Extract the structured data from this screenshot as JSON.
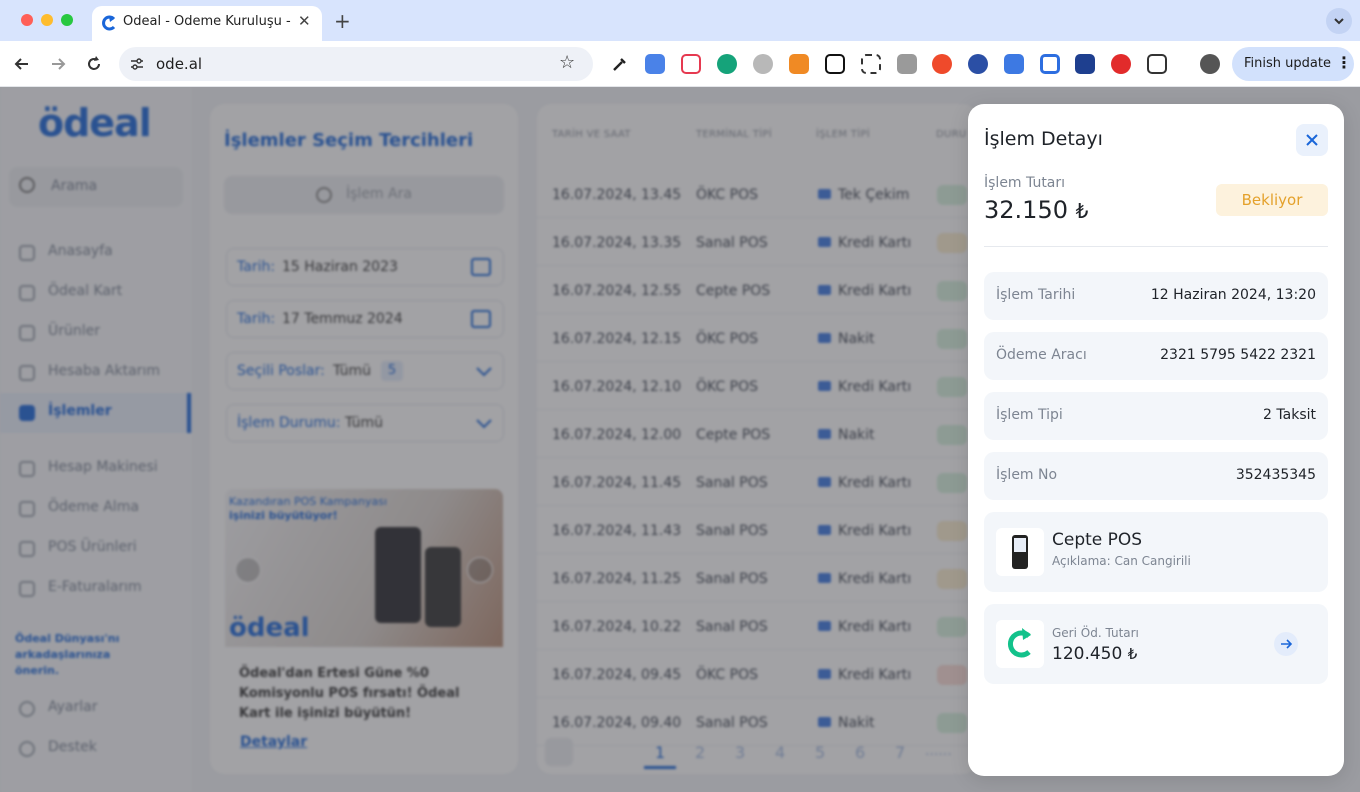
{
  "browser": {
    "tab_title": "Ödeal - Ödeme Kuruluşu - POS",
    "url": "ode.al",
    "finish_update_label": "Finish update",
    "traffic_colors": [
      "#ff5f57",
      "#febc2e",
      "#28c840"
    ]
  },
  "sidebar": {
    "logo": "ödeal",
    "search_label": "Arama",
    "items": [
      {
        "label": "Anasayfa",
        "icon": "home-icon"
      },
      {
        "label": "Ödeal Kart",
        "icon": "card-icon"
      },
      {
        "label": "Ürünler",
        "icon": "product-icon"
      },
      {
        "label": "Hesaba Aktarım",
        "icon": "transfer-icon"
      },
      {
        "label": "İşlemler",
        "icon": "transactions-icon"
      },
      {
        "label": "Hesap Makinesi",
        "icon": "calculator-icon"
      },
      {
        "label": "Ödeme Alma",
        "icon": "payment-icon"
      },
      {
        "label": "POS Ürünleri",
        "icon": "pos-icon"
      },
      {
        "label": "E-Faturalarım",
        "icon": "invoice-icon"
      },
      {
        "label": "Ayarlar",
        "icon": "settings-icon"
      },
      {
        "label": "Destek",
        "icon": "support-icon"
      }
    ],
    "promo": "Ödeal Dünyası'nı arkadaşlarınıza önerin."
  },
  "filters": {
    "title": "İşlemler Seçim Tercihleri",
    "search_placeholder": "İşlem Ara",
    "date_from_label": "Tarih:",
    "date_from_value": "15 Haziran 2023",
    "date_to_label": "Tarih:",
    "date_to_value": "17 Temmuz 2024",
    "pos_label": "Seçili Poslar:",
    "pos_value": "Tümü",
    "pos_count": "5",
    "status_label": "İşlem Durumu:",
    "status_value": "Tümü",
    "banner_line1": "Kazandıran POS Kampanyası",
    "banner_line2": "işinizi büyütüyor!",
    "banner_logo": "ödeal",
    "promo_text": "Ödeal'dan Ertesi Güne %0 Komisyonlu POS fırsatı! Ödeal Kart ile işinizi büyütün!",
    "promo_link": "Detaylar"
  },
  "table": {
    "headers": [
      "TARİH VE SAAT",
      "TERMİNAL TİPİ",
      "İŞLEM TİPİ",
      "DURU"
    ],
    "rows": [
      {
        "date": "16.07.2024, 13.45",
        "terminal": "ÖKC POS",
        "type": "Tek Çekim",
        "status_color": "#d7f2df"
      },
      {
        "date": "16.07.2024, 13.35",
        "terminal": "Sanal POS",
        "type": "Kredi Kartı",
        "status_color": "#fbedcf"
      },
      {
        "date": "16.07.2024, 12.55",
        "terminal": "Cepte POS",
        "type": "Kredi Kartı",
        "status_color": "#d7f2df"
      },
      {
        "date": "16.07.2024, 12.15",
        "terminal": "ÖKC POS",
        "type": "Nakit",
        "status_color": "#d7f2df"
      },
      {
        "date": "16.07.2024, 12.10",
        "terminal": "ÖKC POS",
        "type": "Kredi Kartı",
        "status_color": "#d7f2df"
      },
      {
        "date": "16.07.2024, 12.00",
        "terminal": "Cepte POS",
        "type": "Nakit",
        "status_color": "#d7f2df"
      },
      {
        "date": "16.07.2024, 11.45",
        "terminal": "Sanal POS",
        "type": "Kredi Kartı",
        "status_color": "#d7f2df"
      },
      {
        "date": "16.07.2024, 11.43",
        "terminal": "Sanal POS",
        "type": "Kredi Kartı",
        "status_color": "#fbedcf"
      },
      {
        "date": "16.07.2024, 11.25",
        "terminal": "Sanal POS",
        "type": "Kredi Kartı",
        "status_color": "#fbedcf"
      },
      {
        "date": "16.07.2024, 10.22",
        "terminal": "Sanal POS",
        "type": "Kredi Kartı",
        "status_color": "#d7f2df"
      },
      {
        "date": "16.07.2024, 09.45",
        "terminal": "ÖKC POS",
        "type": "Kredi Kartı",
        "status_color": "#fbdcd6"
      },
      {
        "date": "16.07.2024, 09.40",
        "terminal": "Sanal POS",
        "type": "Nakit",
        "status_color": "#d7f2df"
      }
    ],
    "pages": [
      "1",
      "2",
      "3",
      "4",
      "5",
      "6",
      "7"
    ],
    "ellipsis": "......"
  },
  "detail": {
    "title": "İşlem Detayı",
    "amount_label": "İşlem Tutarı",
    "amount_value": "32.150",
    "currency": "₺",
    "status_badge": "Bekliyor",
    "fields": [
      {
        "label": "İşlem Tarihi",
        "value": "12 Haziran 2024, 13:20"
      },
      {
        "label": "Ödeme Aracı",
        "value": "2321 5795 5422 2321"
      },
      {
        "label": "İşlem Tipi",
        "value": "2 Taksit"
      },
      {
        "label": "İşlem No",
        "value": "352435345"
      }
    ],
    "device_title": "Cepte POS",
    "device_desc": "Açıklama: Can Cangirili",
    "refund_label": "Geri Öd. Tutarı",
    "refund_value": "120.450",
    "refund_currency": "₺"
  },
  "colors": {
    "brand": "#1a66d9",
    "accent_green": "#13c28b",
    "pending_bg": "#fdf2dd",
    "pending_text": "#e4a12b"
  }
}
